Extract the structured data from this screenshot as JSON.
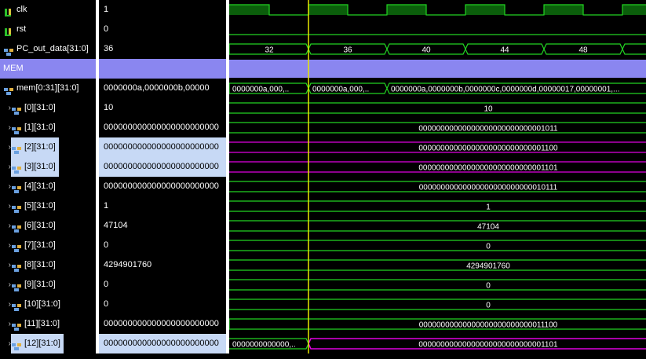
{
  "signals": [
    {
      "name": "clk",
      "value": "1",
      "icon": "bit-signal-icon",
      "expandable": false,
      "selected": false
    },
    {
      "name": "rst",
      "value": "0",
      "icon": "bit-signal-icon",
      "expandable": false,
      "selected": false
    },
    {
      "name": "PC_out_data[31:0]",
      "value": "36",
      "icon": "bus-signal-icon",
      "expandable": false,
      "selected": false
    },
    {
      "name": "MEM",
      "value": "",
      "icon": "",
      "divider": true
    },
    {
      "name": "mem[0:31][31:0]",
      "value": "0000000a,0000000b,00000",
      "icon": "bus-signal-icon",
      "expandable": false,
      "selected": false
    },
    {
      "name": "[0][31:0]",
      "value": "10",
      "icon": "bus-signal-icon",
      "expandable": true,
      "selected": false
    },
    {
      "name": "[1][31:0]",
      "value": "000000000000000000000000",
      "icon": "bus-signal-icon",
      "expandable": true,
      "selected": false
    },
    {
      "name": "[2][31:0]",
      "value": "000000000000000000000000",
      "icon": "bus-signal-icon",
      "expandable": true,
      "selected": true
    },
    {
      "name": "[3][31:0]",
      "value": "000000000000000000000000",
      "icon": "bus-signal-icon",
      "expandable": true,
      "selected": true
    },
    {
      "name": "[4][31:0]",
      "value": "000000000000000000000000",
      "icon": "bus-signal-icon",
      "expandable": true,
      "selected": false
    },
    {
      "name": "[5][31:0]",
      "value": "1",
      "icon": "bus-signal-icon",
      "expandable": true,
      "selected": false
    },
    {
      "name": "[6][31:0]",
      "value": "47104",
      "icon": "bus-signal-icon",
      "expandable": true,
      "selected": false
    },
    {
      "name": "[7][31:0]",
      "value": "0",
      "icon": "bus-signal-icon",
      "expandable": true,
      "selected": false
    },
    {
      "name": "[8][31:0]",
      "value": "4294901760",
      "icon": "bus-signal-icon",
      "expandable": true,
      "selected": false
    },
    {
      "name": "[9][31:0]",
      "value": "0",
      "icon": "bus-signal-icon",
      "expandable": true,
      "selected": false
    },
    {
      "name": "[10][31:0]",
      "value": "0",
      "icon": "bus-signal-icon",
      "expandable": true,
      "selected": false
    },
    {
      "name": "[11][31:0]",
      "value": "000000000000000000000000",
      "icon": "bus-signal-icon",
      "expandable": true,
      "selected": false
    },
    {
      "name": "[12][31:0]",
      "value": "000000000000000000000000",
      "icon": "bus-signal-icon",
      "expandable": true,
      "selected": true
    }
  ],
  "waves": {
    "pc_labels": [
      "32",
      "36",
      "40",
      "44",
      "48"
    ],
    "mem_labels": [
      "0000000a,000,..",
      "0000000a,000,..",
      "0000000a,0000000b,0000000c,0000000d,00000017,00000001,..."
    ],
    "row_labels": {
      "r0": "10",
      "r1": "00000000000000000000000000001011",
      "r2": "00000000000000000000000000001100",
      "r3": "00000000000000000000000000001101",
      "r4": "00000000000000000000000000010111",
      "r5": "1",
      "r6": "47104",
      "r7": "0",
      "r8": "4294901760",
      "r9": "0",
      "r10": "0",
      "r11": "00000000000000000000000000011100",
      "r12a": "0000000000000,..",
      "r12b": "00000000000000000000000000001101"
    }
  },
  "colors": {
    "wave_green": "#22d422",
    "clk_fill": "#0b5e0b",
    "highlight_magenta": "#e000e0",
    "cursor_yellow": "#e8e800",
    "divider_purple": "#8a86f0",
    "selection_blue": "#c7d9f5"
  }
}
